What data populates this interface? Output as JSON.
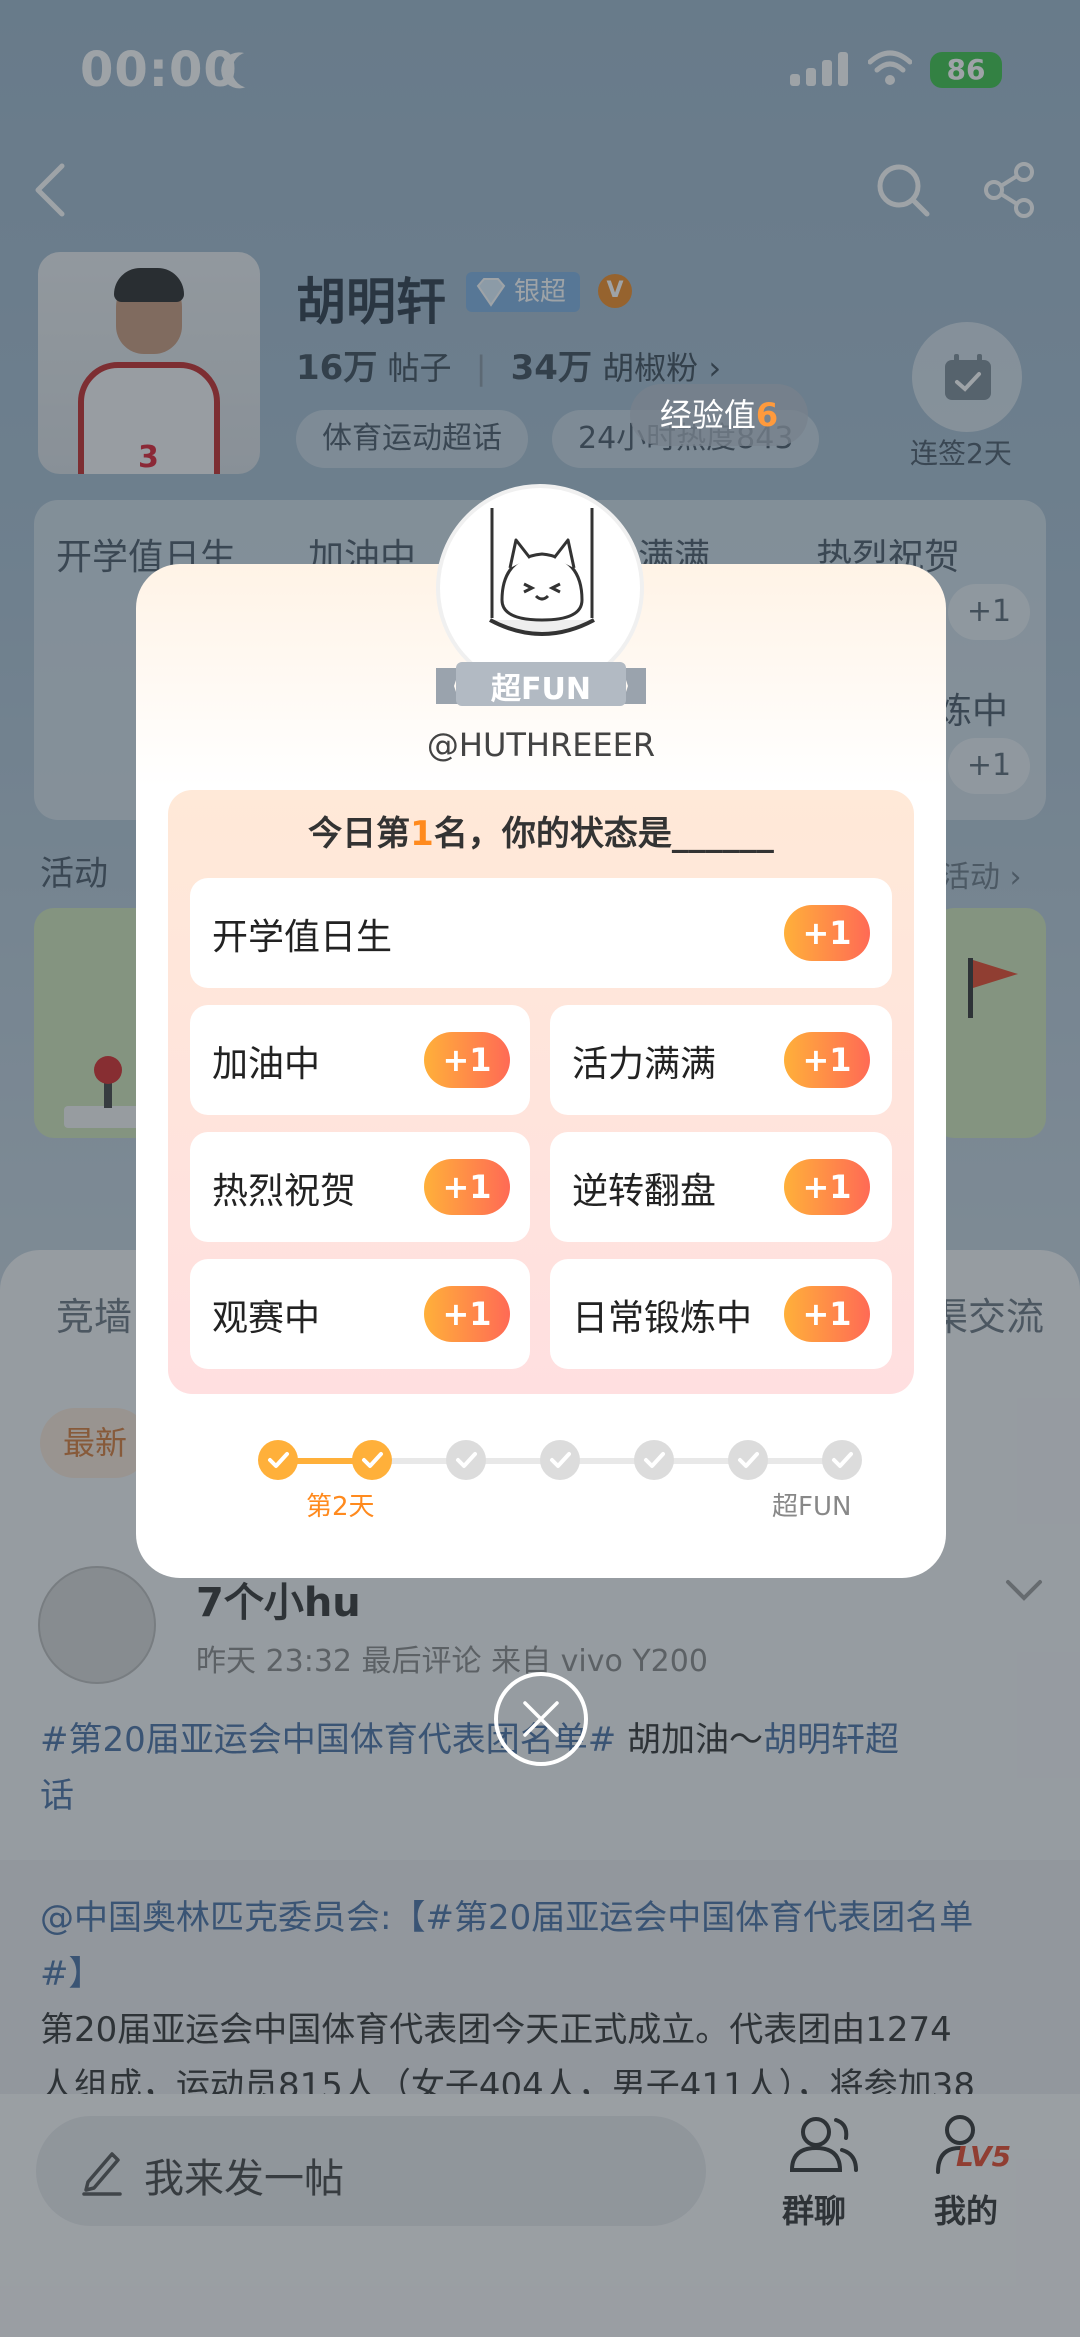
{
  "status_bar": {
    "time": "00:00",
    "battery": "86"
  },
  "profile": {
    "name": "胡明轩",
    "badge": "银超",
    "posts_count": "16万",
    "posts_label": "帖子",
    "fans_count": "34万",
    "fans_label": "胡椒粉",
    "fans_arrow": "›",
    "chips": [
      "体育运动超话",
      "24小时热度843"
    ],
    "checkin_label": "连签2天"
  },
  "hot_grid": {
    "cells": [
      "开学值日生",
      "加油中",
      "满满",
      "热烈祝贺",
      "炼中"
    ],
    "plus": "+1"
  },
  "activity": {
    "title": "活动",
    "more": "活动 ›"
  },
  "tabs": {
    "left": "竞墙",
    "right": "渠交流",
    "newest": "最新"
  },
  "post": {
    "user": "7个小hu",
    "meta": "昨天 23:32 最后评论  来自 vivo Y200",
    "line1_link": "#第20届亚运会中国体育代表团名单#",
    "line1_text": " 胡加油～",
    "line1_topic": "胡明轩超",
    "line2": "话",
    "quote_line1": "@中国奥林匹克委员会:【#第20届亚运会中国体育代表团名单",
    "quote_line2": "#】",
    "quote_line3": "第20届亚运会中国体育代表团今天正式成立。代表团由1274",
    "quote_line4": "人组成，运动员815人（女子404人，男子411人），将参加38"
  },
  "bottom_bar": {
    "compose_placeholder": "我来发一帖",
    "group_label": "群聊",
    "mine_label": "我的",
    "level": "LV5"
  },
  "modal": {
    "exp_text": "经验值",
    "exp_value": "6",
    "ribbon": "超FUN",
    "username": "@HUTHREEER",
    "prompt_prefix": "今日第",
    "prompt_rank": "1",
    "prompt_suffix": "名，你的状态是______",
    "options": [
      {
        "label": "开学值日生",
        "plus": "+1"
      },
      {
        "label": "加油中",
        "plus": "+1"
      },
      {
        "label": "活力满满",
        "plus": "+1"
      },
      {
        "label": "热烈祝贺",
        "plus": "+1"
      },
      {
        "label": "逆转翻盘",
        "plus": "+1"
      },
      {
        "label": "观赛中",
        "plus": "+1"
      },
      {
        "label": "日常锻炼中",
        "plus": "+1"
      }
    ],
    "progress": {
      "completed_steps": 2,
      "total_steps": 7,
      "current_label": "第2天",
      "end_label": "超FUN"
    },
    "colors": {
      "accent": "#ff8a1e",
      "plus_start": "#ffb03a",
      "plus_end": "#ff6a55"
    }
  }
}
